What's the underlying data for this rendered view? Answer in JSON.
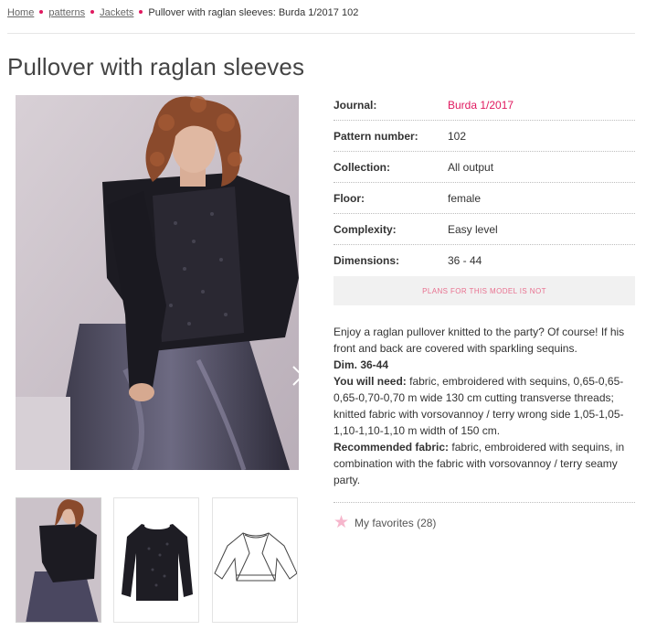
{
  "breadcrumb": {
    "items": [
      "Home",
      "patterns",
      "Jackets"
    ],
    "current": "Pullover with raglan sleeves: Burda 1/2017 102"
  },
  "page_title": "Pullover with raglan sleeves",
  "properties": [
    {
      "label": "Journal:",
      "value": "Burda 1/2017"
    },
    {
      "label": "Pattern number:",
      "value": "102"
    },
    {
      "label": "Collection:",
      "value": "All output"
    },
    {
      "label": "Floor:",
      "value": "female"
    },
    {
      "label": "Complexity:",
      "value": "Easy level"
    },
    {
      "label": "Dimensions:",
      "value": "36 - 44"
    }
  ],
  "plans_notice": "PLANS FOR THIS MODEL IS NOT",
  "description": {
    "intro": "Enjoy a raglan pullover knitted to the party? Of course! If his front and back are covered with sparkling sequins.",
    "dim_label": "Dim. 36-44",
    "need_label": "You will need:",
    "need_text": " fabric, embroidered with sequins, 0,65-0,65-0,65-0,70-0,70 m wide 130 cm cutting transverse threads; knitted fabric with vorsovannoy / terry wrong side 1,05-1,05-1,10-1,10-1,10 m width of 150 cm.",
    "fabric_label": "Recommended fabric:",
    "fabric_text": " fabric, embroidered with sequins, in combination with the fabric with vorsovannoy / terry seamy party."
  },
  "favorites": {
    "label": "My favorites",
    "count": "(28)"
  },
  "colors": {
    "accent": "#e0195f",
    "star": "#f6b6cc",
    "plans_bg": "#f1f1f1"
  },
  "icons": {
    "next": "chevron-right-icon",
    "favorite": "star-icon"
  }
}
